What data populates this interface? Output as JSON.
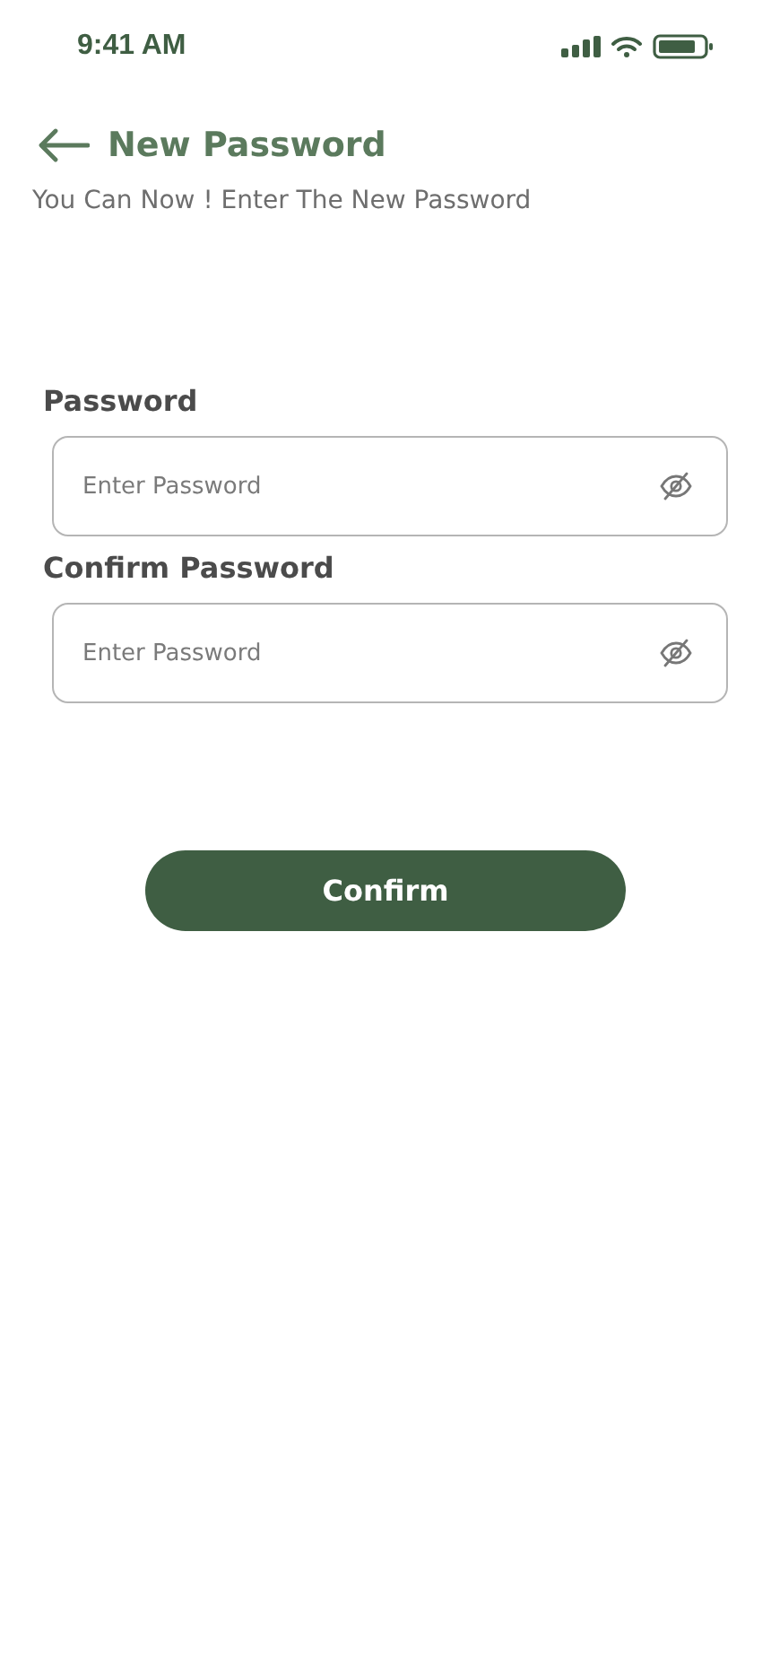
{
  "status_bar": {
    "time": "9:41 AM"
  },
  "header": {
    "title": "New Password"
  },
  "subtitle": "You Can Now ! Enter The New Password",
  "fields": [
    {
      "label": "Password",
      "placeholder": "Enter Password",
      "visible": false
    },
    {
      "label": "Confirm Password",
      "placeholder": "Enter Password",
      "visible": false
    }
  ],
  "button": {
    "label": "Confirm"
  }
}
